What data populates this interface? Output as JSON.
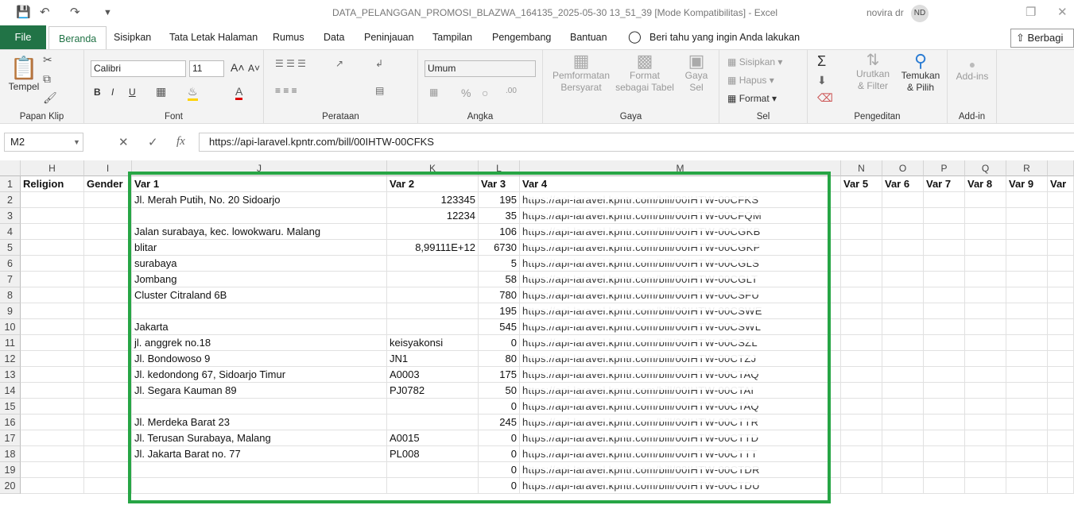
{
  "window": {
    "title": "DATA_PELANGGAN_PROMOSI_BLAZWA_164135_2025-05-30 13_51_39  [Mode Kompatibilitas]  -  Excel",
    "user": "novira dr",
    "initials": "ND"
  },
  "tabs": {
    "file": "File",
    "items": [
      "Beranda",
      "Sisipkan",
      "Tata Letak Halaman",
      "Rumus",
      "Data",
      "Peninjauan",
      "Tampilan",
      "Pengembang",
      "Bantuan"
    ],
    "tellme": "Beri tahu yang ingin Anda lakukan",
    "share": "Berbagi"
  },
  "ribbon": {
    "clipboard": {
      "label": "Papan Klip",
      "paste": "Tempel"
    },
    "font": {
      "label": "Font",
      "name": "Calibri",
      "size": "11",
      "bold": "B",
      "italic": "I",
      "underline": "U"
    },
    "alignment": {
      "label": "Perataan"
    },
    "number": {
      "label": "Angka",
      "format": "Umum"
    },
    "styles": {
      "label": "Gaya",
      "conditional": "Pemformatan Bersyarat",
      "table": "Format sebagai Tabel",
      "cell": "Gaya Sel"
    },
    "cells": {
      "label": "Sel",
      "insert": "Sisipkan",
      "delete": "Hapus",
      "format": "Format"
    },
    "editing": {
      "label": "Pengeditan",
      "sort": "Urutkan & Filter",
      "find": "Temukan & Pilih"
    },
    "addins": {
      "label": "Add-in",
      "button": "Add-ins"
    }
  },
  "formula_bar": {
    "name_box": "M2",
    "formula": "https://api-laravel.kpntr.com/bill/00IHTW-00CFKS",
    "fx": "fx"
  },
  "columns": [
    "H",
    "I",
    "J",
    "K",
    "L",
    "M",
    "N",
    "O",
    "P",
    "Q",
    "R"
  ],
  "headers": {
    "H": "Religion",
    "I": "Gender",
    "J": "Var 1",
    "K": "Var 2",
    "L": "Var 3",
    "M": "Var 4",
    "N": "Var 5",
    "O": "Var 6",
    "P": "Var 7",
    "Q": "Var 8",
    "R": "Var 9",
    "S": "Var"
  },
  "rows": [
    {
      "n": "2",
      "j": "Jl. Merah Putih, No. 20 Sidoarjo",
      "k": "123345",
      "kr": true,
      "l": "195",
      "m": "https://api-laravel.kpntr.com/bill/00IHTW-00CFKS"
    },
    {
      "n": "3",
      "j": "",
      "k": "12234",
      "kr": true,
      "l": "35",
      "m": "https://api-laravel.kpntr.com/bill/00IHTW-00CFQM"
    },
    {
      "n": "4",
      "j": "Jalan surabaya, kec. lowokwaru. Malang",
      "k": "",
      "kr": false,
      "l": "106",
      "m": "https://api-laravel.kpntr.com/bill/00IHTW-00CGKB"
    },
    {
      "n": "5",
      "j": "blitar",
      "k": "8,99111E+12",
      "kr": true,
      "l": "6730",
      "m": "https://api-laravel.kpntr.com/bill/00IHTW-00CGKP"
    },
    {
      "n": "6",
      "j": "surabaya",
      "k": "",
      "kr": false,
      "l": "5",
      "m": "https://api-laravel.kpntr.com/bill/00IHTW-00CGLS"
    },
    {
      "n": "7",
      "j": "Jombang",
      "k": "",
      "kr": false,
      "l": "58",
      "m": "https://api-laravel.kpntr.com/bill/00IHTW-00CGLT"
    },
    {
      "n": "8",
      "j": "Cluster Citraland 6B",
      "k": "",
      "kr": false,
      "l": "780",
      "m": "https://api-laravel.kpntr.com/bill/00IHTW-00CSFU"
    },
    {
      "n": "9",
      "j": "",
      "k": "",
      "kr": false,
      "l": "195",
      "m": "https://api-laravel.kpntr.com/bill/00IHTW-00CSWE"
    },
    {
      "n": "10",
      "j": "Jakarta",
      "k": "",
      "kr": false,
      "l": "545",
      "m": "https://api-laravel.kpntr.com/bill/00IHTW-00CSWL"
    },
    {
      "n": "11",
      "j": "jl. anggrek no.18",
      "k": "keisyakonsi",
      "kr": false,
      "l": "0",
      "m": "https://api-laravel.kpntr.com/bill/00IHTW-00CSZL"
    },
    {
      "n": "12",
      "j": "Jl. Bondowoso 9",
      "k": "JN1",
      "kr": false,
      "l": "80",
      "m": "https://api-laravel.kpntr.com/bill/00IHTW-00CTZJ"
    },
    {
      "n": "13",
      "j": "Jl. kedondong 67, Sidoarjo Timur",
      "k": "A0003",
      "kr": false,
      "l": "175",
      "m": "https://api-laravel.kpntr.com/bill/00IHTW-00CTAQ"
    },
    {
      "n": "14",
      "j": "Jl. Segara Kauman 89",
      "k": "PJ0782",
      "kr": false,
      "l": "50",
      "m": "https://api-laravel.kpntr.com/bill/00IHTW-00CTAI"
    },
    {
      "n": "15",
      "j": "",
      "k": "",
      "kr": false,
      "l": "0",
      "m": "https://api-laravel.kpntr.com/bill/00IHTW-00CTAQ"
    },
    {
      "n": "16",
      "j": "Jl. Merdeka Barat 23",
      "k": "",
      "kr": false,
      "l": "245",
      "m": "https://api-laravel.kpntr.com/bill/00IHTW-00CTTR"
    },
    {
      "n": "17",
      "j": "Jl. Terusan Surabaya, Malang",
      "k": "A0015",
      "kr": false,
      "l": "0",
      "m": "https://api-laravel.kpntr.com/bill/00IHTW-00CTTD"
    },
    {
      "n": "18",
      "j": "Jl. Jakarta Barat no. 77",
      "k": "PL008",
      "kr": false,
      "l": "0",
      "m": "https://api-laravel.kpntr.com/bill/00IHTW-00CTTT"
    },
    {
      "n": "19",
      "j": "",
      "k": "",
      "kr": false,
      "l": "0",
      "m": "https://api-laravel.kpntr.com/bill/00IHTW-00CTDR"
    },
    {
      "n": "20",
      "j": "",
      "k": "",
      "kr": false,
      "l": "0",
      "m": "https://api-laravel.kpntr.com/bill/00IHTW-00CTDU"
    }
  ],
  "row1": "1",
  "highlight_color": "#27a545",
  "accent": "#217346"
}
